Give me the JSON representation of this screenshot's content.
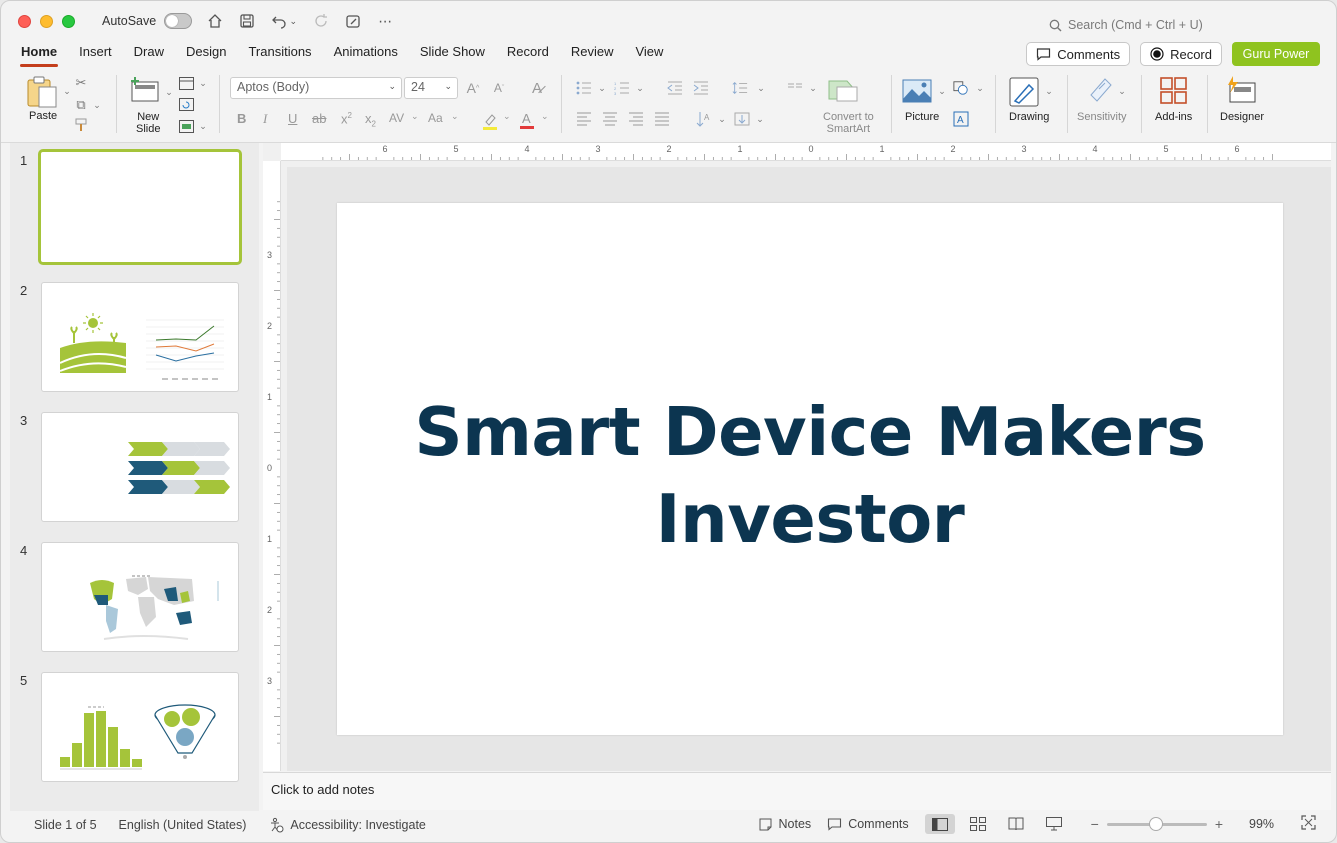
{
  "titlebar": {
    "autosave_label": "AutoSave",
    "search_placeholder": "Search (Cmd + Ctrl + U)"
  },
  "tabs": [
    {
      "label": "Home",
      "active": true
    },
    {
      "label": "Insert"
    },
    {
      "label": "Draw"
    },
    {
      "label": "Design"
    },
    {
      "label": "Transitions"
    },
    {
      "label": "Animations"
    },
    {
      "label": "Slide Show"
    },
    {
      "label": "Record"
    },
    {
      "label": "Review"
    },
    {
      "label": "View"
    }
  ],
  "header_buttons": {
    "comments": "Comments",
    "record": "Record",
    "guru": "Guru Power"
  },
  "ribbon": {
    "paste": "Paste",
    "new_slide_line1": "New",
    "new_slide_line2": "Slide",
    "font_name": "Aptos (Body)",
    "font_size": "24",
    "convert_line1": "Convert to",
    "convert_line2": "SmartArt",
    "picture": "Picture",
    "drawing": "Drawing",
    "sensitivity": "Sensitivity",
    "addins": "Add-ins",
    "designer": "Designer"
  },
  "slides": [
    {
      "num": "1"
    },
    {
      "num": "2"
    },
    {
      "num": "3"
    },
    {
      "num": "4"
    },
    {
      "num": "5"
    }
  ],
  "colors": {
    "accent": "#a5c43a",
    "title": "#0c3550",
    "tab_underline": "#c43e1c",
    "guru": "#8fc31f"
  },
  "slide": {
    "title_line1": "Smart Device Makers",
    "title_line2": "Investor"
  },
  "notes_placeholder": "Click to add notes",
  "status": {
    "slide_of": "Slide 1 of 5",
    "language": "English (United States)",
    "accessibility": "Accessibility: Investigate",
    "notes": "Notes",
    "comments": "Comments",
    "zoom": "99%"
  },
  "ruler": {
    "h_ticks": [
      "6",
      "5",
      "4",
      "3",
      "2",
      "1",
      "0",
      "1",
      "2",
      "3",
      "4",
      "5",
      "6"
    ],
    "v_ticks": [
      "3",
      "2",
      "1",
      "0",
      "1",
      "2",
      "3"
    ]
  }
}
